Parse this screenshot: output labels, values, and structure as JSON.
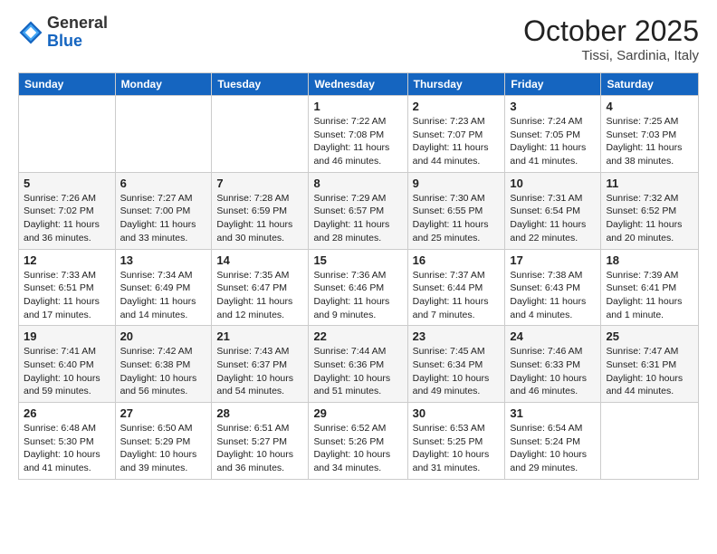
{
  "header": {
    "logo_general": "General",
    "logo_blue": "Blue",
    "month": "October 2025",
    "location": "Tissi, Sardinia, Italy"
  },
  "weekdays": [
    "Sunday",
    "Monday",
    "Tuesday",
    "Wednesday",
    "Thursday",
    "Friday",
    "Saturday"
  ],
  "rows": [
    [
      {
        "day": "",
        "info": ""
      },
      {
        "day": "",
        "info": ""
      },
      {
        "day": "",
        "info": ""
      },
      {
        "day": "1",
        "info": "Sunrise: 7:22 AM\nSunset: 7:08 PM\nDaylight: 11 hours and 46 minutes."
      },
      {
        "day": "2",
        "info": "Sunrise: 7:23 AM\nSunset: 7:07 PM\nDaylight: 11 hours and 44 minutes."
      },
      {
        "day": "3",
        "info": "Sunrise: 7:24 AM\nSunset: 7:05 PM\nDaylight: 11 hours and 41 minutes."
      },
      {
        "day": "4",
        "info": "Sunrise: 7:25 AM\nSunset: 7:03 PM\nDaylight: 11 hours and 38 minutes."
      }
    ],
    [
      {
        "day": "5",
        "info": "Sunrise: 7:26 AM\nSunset: 7:02 PM\nDaylight: 11 hours and 36 minutes."
      },
      {
        "day": "6",
        "info": "Sunrise: 7:27 AM\nSunset: 7:00 PM\nDaylight: 11 hours and 33 minutes."
      },
      {
        "day": "7",
        "info": "Sunrise: 7:28 AM\nSunset: 6:59 PM\nDaylight: 11 hours and 30 minutes."
      },
      {
        "day": "8",
        "info": "Sunrise: 7:29 AM\nSunset: 6:57 PM\nDaylight: 11 hours and 28 minutes."
      },
      {
        "day": "9",
        "info": "Sunrise: 7:30 AM\nSunset: 6:55 PM\nDaylight: 11 hours and 25 minutes."
      },
      {
        "day": "10",
        "info": "Sunrise: 7:31 AM\nSunset: 6:54 PM\nDaylight: 11 hours and 22 minutes."
      },
      {
        "day": "11",
        "info": "Sunrise: 7:32 AM\nSunset: 6:52 PM\nDaylight: 11 hours and 20 minutes."
      }
    ],
    [
      {
        "day": "12",
        "info": "Sunrise: 7:33 AM\nSunset: 6:51 PM\nDaylight: 11 hours and 17 minutes."
      },
      {
        "day": "13",
        "info": "Sunrise: 7:34 AM\nSunset: 6:49 PM\nDaylight: 11 hours and 14 minutes."
      },
      {
        "day": "14",
        "info": "Sunrise: 7:35 AM\nSunset: 6:47 PM\nDaylight: 11 hours and 12 minutes."
      },
      {
        "day": "15",
        "info": "Sunrise: 7:36 AM\nSunset: 6:46 PM\nDaylight: 11 hours and 9 minutes."
      },
      {
        "day": "16",
        "info": "Sunrise: 7:37 AM\nSunset: 6:44 PM\nDaylight: 11 hours and 7 minutes."
      },
      {
        "day": "17",
        "info": "Sunrise: 7:38 AM\nSunset: 6:43 PM\nDaylight: 11 hours and 4 minutes."
      },
      {
        "day": "18",
        "info": "Sunrise: 7:39 AM\nSunset: 6:41 PM\nDaylight: 11 hours and 1 minute."
      }
    ],
    [
      {
        "day": "19",
        "info": "Sunrise: 7:41 AM\nSunset: 6:40 PM\nDaylight: 10 hours and 59 minutes."
      },
      {
        "day": "20",
        "info": "Sunrise: 7:42 AM\nSunset: 6:38 PM\nDaylight: 10 hours and 56 minutes."
      },
      {
        "day": "21",
        "info": "Sunrise: 7:43 AM\nSunset: 6:37 PM\nDaylight: 10 hours and 54 minutes."
      },
      {
        "day": "22",
        "info": "Sunrise: 7:44 AM\nSunset: 6:36 PM\nDaylight: 10 hours and 51 minutes."
      },
      {
        "day": "23",
        "info": "Sunrise: 7:45 AM\nSunset: 6:34 PM\nDaylight: 10 hours and 49 minutes."
      },
      {
        "day": "24",
        "info": "Sunrise: 7:46 AM\nSunset: 6:33 PM\nDaylight: 10 hours and 46 minutes."
      },
      {
        "day": "25",
        "info": "Sunrise: 7:47 AM\nSunset: 6:31 PM\nDaylight: 10 hours and 44 minutes."
      }
    ],
    [
      {
        "day": "26",
        "info": "Sunrise: 6:48 AM\nSunset: 5:30 PM\nDaylight: 10 hours and 41 minutes."
      },
      {
        "day": "27",
        "info": "Sunrise: 6:50 AM\nSunset: 5:29 PM\nDaylight: 10 hours and 39 minutes."
      },
      {
        "day": "28",
        "info": "Sunrise: 6:51 AM\nSunset: 5:27 PM\nDaylight: 10 hours and 36 minutes."
      },
      {
        "day": "29",
        "info": "Sunrise: 6:52 AM\nSunset: 5:26 PM\nDaylight: 10 hours and 34 minutes."
      },
      {
        "day": "30",
        "info": "Sunrise: 6:53 AM\nSunset: 5:25 PM\nDaylight: 10 hours and 31 minutes."
      },
      {
        "day": "31",
        "info": "Sunrise: 6:54 AM\nSunset: 5:24 PM\nDaylight: 10 hours and 29 minutes."
      },
      {
        "day": "",
        "info": ""
      }
    ]
  ]
}
